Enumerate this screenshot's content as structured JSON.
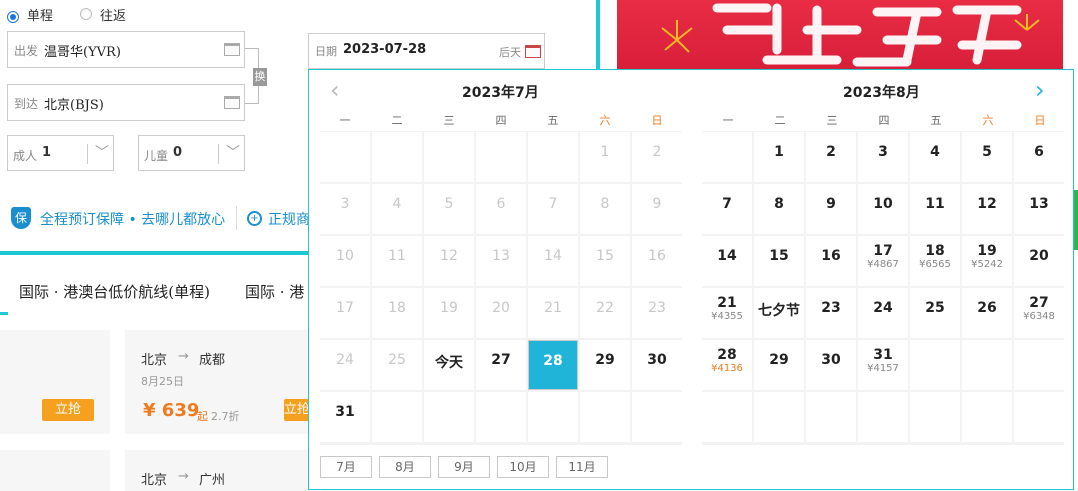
{
  "trip_type": {
    "oneway": "单程",
    "round": "往返"
  },
  "from": {
    "label": "出发",
    "value": "温哥华(YVR)"
  },
  "to": {
    "label": "到达",
    "value": "北京(BJS)"
  },
  "swap_label": "换",
  "date": {
    "label": "日期",
    "value": "2023-07-28",
    "hint": "后天"
  },
  "adult": {
    "label": "成人",
    "value": "1"
  },
  "child": {
    "label": "儿童",
    "value": "0"
  },
  "guarantee": {
    "badge": "保",
    "text": "全程预订保障 • 去哪儿都放心",
    "text2": "正规商"
  },
  "tabs": [
    "国际 · 港澳台低价航线(单程)",
    "国际 · 港"
  ],
  "routes": [
    {
      "from": "北京",
      "arrow": "→",
      "to": "成都",
      "date": "8月25日",
      "price": "¥ 639",
      "suffix": "起",
      "discount": "2.7折"
    },
    {
      "from": "北京",
      "arrow": "→",
      "to": "广州"
    }
  ],
  "buy_label": "立抢",
  "calendar": {
    "weekdays": [
      "一",
      "二",
      "三",
      "四",
      "五",
      "六",
      "日"
    ],
    "july": {
      "title": "2023年7月",
      "cells": [
        {
          "d": ""
        },
        {
          "d": ""
        },
        {
          "d": ""
        },
        {
          "d": ""
        },
        {
          "d": ""
        },
        {
          "d": "1",
          "g": true
        },
        {
          "d": "2",
          "g": true
        },
        {
          "d": "3",
          "g": true
        },
        {
          "d": "4",
          "g": true
        },
        {
          "d": "5",
          "g": true
        },
        {
          "d": "6",
          "g": true
        },
        {
          "d": "7",
          "g": true
        },
        {
          "d": "8",
          "g": true
        },
        {
          "d": "9",
          "g": true
        },
        {
          "d": "10",
          "g": true
        },
        {
          "d": "11",
          "g": true
        },
        {
          "d": "12",
          "g": true
        },
        {
          "d": "13",
          "g": true
        },
        {
          "d": "14",
          "g": true
        },
        {
          "d": "15",
          "g": true
        },
        {
          "d": "16",
          "g": true
        },
        {
          "d": "17",
          "g": true
        },
        {
          "d": "18",
          "g": true
        },
        {
          "d": "19",
          "g": true
        },
        {
          "d": "20",
          "g": true
        },
        {
          "d": "21",
          "g": true
        },
        {
          "d": "22",
          "g": true
        },
        {
          "d": "23",
          "g": true
        },
        {
          "d": "24",
          "g": true
        },
        {
          "d": "25",
          "g": true
        },
        {
          "d": "今天"
        },
        {
          "d": "27"
        },
        {
          "d": "28",
          "s": true
        },
        {
          "d": "29"
        },
        {
          "d": "30"
        },
        {
          "d": "31"
        },
        {
          "d": ""
        },
        {
          "d": ""
        },
        {
          "d": ""
        },
        {
          "d": ""
        },
        {
          "d": ""
        },
        {
          "d": ""
        }
      ]
    },
    "august": {
      "title": "2023年8月",
      "cells": [
        {
          "d": ""
        },
        {
          "d": "1"
        },
        {
          "d": "2"
        },
        {
          "d": "3"
        },
        {
          "d": "4"
        },
        {
          "d": "5"
        },
        {
          "d": "6"
        },
        {
          "d": "7"
        },
        {
          "d": "8"
        },
        {
          "d": "9"
        },
        {
          "d": "10"
        },
        {
          "d": "11"
        },
        {
          "d": "12"
        },
        {
          "d": "13"
        },
        {
          "d": "14"
        },
        {
          "d": "15"
        },
        {
          "d": "16"
        },
        {
          "d": "17",
          "p": "¥4867"
        },
        {
          "d": "18",
          "p": "¥6565"
        },
        {
          "d": "19",
          "p": "¥5242"
        },
        {
          "d": "20"
        },
        {
          "d": "21",
          "p": "¥4355"
        },
        {
          "d": "七夕节"
        },
        {
          "d": "23"
        },
        {
          "d": "24"
        },
        {
          "d": "25"
        },
        {
          "d": "26"
        },
        {
          "d": "27",
          "p": "¥6348"
        },
        {
          "d": "28",
          "p": "¥4136",
          "po": true
        },
        {
          "d": "29"
        },
        {
          "d": "30"
        },
        {
          "d": "31",
          "p": "¥4157"
        },
        {
          "d": ""
        },
        {
          "d": ""
        },
        {
          "d": ""
        },
        {
          "d": ""
        },
        {
          "d": ""
        },
        {
          "d": ""
        },
        {
          "d": ""
        },
        {
          "d": ""
        },
        {
          "d": ""
        },
        {
          "d": ""
        }
      ]
    },
    "months": [
      "7月",
      "8月",
      "9月",
      "10月",
      "11月"
    ],
    "prev": "‹",
    "next": "›"
  },
  "colors": {
    "accent": "#1fb4d8",
    "orange": "#f6a020",
    "weekend": "#f07a1e",
    "promo": "#e0263f"
  }
}
